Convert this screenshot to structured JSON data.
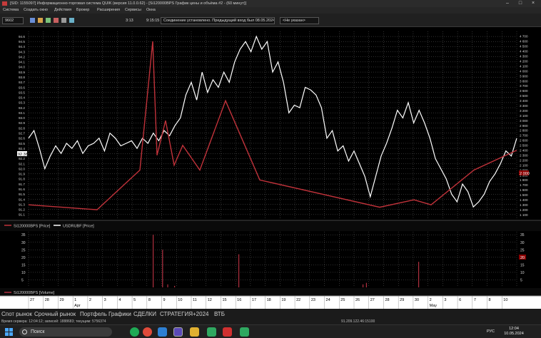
{
  "window": {
    "title": "[SID: 1155097] Информационно-торговая система QUIK (версия 11.0.0.62) - [Si120000BPS График цены и объёма #2 - (60 минут)]",
    "controls": [
      "–",
      "□",
      "×"
    ]
  },
  "menu": [
    "Система",
    "Создать окно",
    "Действия",
    "Брокер",
    "Расширения",
    "Сервисы",
    "Окна"
  ],
  "toolbar": {
    "interval": "9602",
    "time1": "3:13",
    "time2": "9:15:15",
    "connection_status": "Соединение установлено. Предыдущий вход был 08.05.2024.",
    "account_placeholder": "<Не указан>"
  },
  "colors": {
    "price_line": "#ffffff",
    "si_line": "#c0323a",
    "volume": "#b03040",
    "grid": "#7a7a7a",
    "background": "#000000",
    "price_marker": "#8b0000"
  },
  "chart_data": [
    {
      "type": "line",
      "title": "",
      "y_left_label": "",
      "y_left_range": [
        91.0,
        94.7
      ],
      "y_left_ticks": [
        "94.6",
        "94.5",
        "94.4",
        "94.3",
        "94.2",
        "94.1",
        "94.0",
        "93.9",
        "93.8",
        "93.7",
        "93.6",
        "93.5",
        "93.4",
        "93.3",
        "93.2",
        "93.1",
        "93.0",
        "92.9",
        "92.8",
        "92.7",
        "92.6",
        "92.5",
        "92.4",
        "92.3",
        "92.2",
        "92.1",
        "92.0",
        "91.9",
        "91.8",
        "91.7",
        "91.6",
        "91.5",
        "91.4",
        "91.3",
        "91.2",
        "91.1"
      ],
      "left_marker": "92.385",
      "y_right_range": [
        1000,
        4800
      ],
      "y_right_ticks": [
        "4 700",
        "4 600",
        "4 500",
        "4 400",
        "4 300",
        "4 200",
        "4 100",
        "4 000",
        "3 900",
        "3 800",
        "3 700",
        "3 600",
        "3 500",
        "3 400",
        "3 300",
        "3 200",
        "3 100",
        "3 000",
        "2 900",
        "2 800",
        "2 700",
        "2 600",
        "2 500",
        "2 400",
        "2 300",
        "2 200",
        "2 100",
        "2 000",
        "1 900",
        "1 800",
        "1 700",
        "1 600",
        "1 500",
        "1 400",
        "1 300",
        "1 200",
        "1 100"
      ],
      "right_marker": "2 000",
      "legend": [
        {
          "name": "Si120000BPS [Price]",
          "color": "#c0323a"
        },
        {
          "name": "USDRUBF [Price]",
          "color": "#ffffff"
        }
      ],
      "series": [
        {
          "name": "USDRUBF [Price]",
          "axis": "left",
          "x": [
            0,
            0.5,
            1,
            1.5,
            2,
            2.5,
            3,
            3.5,
            4,
            4.5,
            5,
            5.5,
            6,
            6.5,
            7,
            7.5,
            8,
            8.5,
            9,
            9.5,
            10,
            10.5,
            11,
            11.5,
            12,
            12.5,
            13,
            13.5,
            14,
            14.5,
            15,
            15.5,
            16,
            16.5,
            17,
            17.5,
            18,
            18.5,
            19,
            19.5,
            20,
            20.5,
            21,
            21.5,
            22,
            22.5,
            23,
            23.5,
            24,
            24.5,
            25,
            25.5,
            26,
            26.5,
            27,
            27.5,
            28,
            28.5,
            29,
            29.5,
            30,
            30.5,
            31,
            31.5,
            32,
            32.5,
            33,
            33.5,
            34,
            34.5,
            35,
            35.5,
            36,
            36.5,
            37,
            37.5,
            38,
            38.5,
            39,
            39.5,
            40,
            40.5,
            41,
            41.5,
            42,
            42.5,
            43,
            43.5,
            44,
            44.5,
            45
          ],
          "values": [
            92.6,
            92.75,
            92.4,
            92.0,
            92.25,
            92.45,
            92.3,
            92.5,
            92.4,
            92.55,
            92.3,
            92.45,
            92.5,
            92.6,
            92.35,
            92.7,
            92.6,
            92.45,
            92.5,
            92.55,
            92.4,
            92.6,
            92.5,
            92.7,
            92.55,
            92.75,
            92.65,
            92.85,
            93.0,
            93.45,
            93.7,
            93.35,
            93.9,
            93.5,
            93.75,
            93.6,
            93.9,
            93.7,
            94.1,
            94.35,
            94.5,
            94.3,
            94.6,
            94.35,
            94.5,
            93.9,
            94.1,
            93.7,
            93.1,
            93.25,
            93.2,
            93.6,
            93.55,
            93.45,
            93.2,
            92.6,
            92.75,
            92.35,
            92.45,
            92.15,
            92.35,
            92.1,
            91.85,
            91.45,
            91.85,
            92.25,
            92.5,
            92.8,
            93.15,
            93.0,
            93.3,
            92.9,
            93.15,
            92.9,
            92.6,
            92.2,
            92.0,
            91.8,
            91.5,
            91.35,
            91.7,
            91.55,
            91.25,
            91.35,
            91.5,
            91.75,
            91.9,
            92.1,
            92.35,
            92.25,
            92.6
          ],
          "color": "#ffffff"
        },
        {
          "name": "Si120000BPS [Price]",
          "axis": "right",
          "x": [
            0,
            8,
            13,
            14.5,
            15,
            16,
            17,
            18,
            20,
            23,
            27,
            41,
            45,
            47,
            52,
            57
          ],
          "values": [
            1300,
            1200,
            2000,
            4600,
            2300,
            3000,
            2100,
            2500,
            2000,
            3400,
            1800,
            1250,
            1400,
            1300,
            2000,
            2400
          ],
          "color": "#c0323a"
        }
      ]
    },
    {
      "type": "bar",
      "title": "",
      "y_range": [
        0,
        37
      ],
      "y_ticks": [
        "35",
        "30",
        "25",
        "20",
        "15",
        "10",
        "5"
      ],
      "right_marker": "20",
      "legend": [
        {
          "name": "Si120000BPS [Volume]",
          "color": "#b03040"
        }
      ],
      "series": [
        {
          "name": "Si120000BPS [Volume]",
          "x": [
            14.5,
            15.6,
            16.2,
            17.0,
            24.5,
            39.0,
            39.4,
            45.5
          ],
          "values": [
            35,
            25,
            2,
            1,
            22,
            2,
            3,
            17
          ]
        }
      ]
    }
  ],
  "x_axis": {
    "labels": [
      "27",
      "28",
      "29",
      "1",
      "2",
      "3",
      "4",
      "5",
      "8",
      "9",
      "10",
      "11",
      "12",
      "15",
      "16",
      "17",
      "18",
      "19",
      "22",
      "23",
      "24",
      "25",
      "26",
      "27",
      "28",
      "29",
      "30",
      "2",
      "3",
      "6",
      "7",
      "8",
      "10"
    ],
    "months": [
      "Apr",
      "May"
    ]
  },
  "tabs": [
    "Спот рынок",
    "Срочный рынок",
    "Портфель",
    "Графики",
    "СДЕЛКИ",
    "СТРАТЕГИЯ+2024",
    "ВТБ"
  ],
  "status": {
    "server_time": "Время сервера: 12:04:12; записей: 1888683; текущим: 5756374",
    "server_address": "91.209.122.46:15100"
  },
  "taskbar": {
    "search_placeholder": "Поиск",
    "language": "РУС",
    "time": "12:04",
    "date": "10.05.2024"
  }
}
